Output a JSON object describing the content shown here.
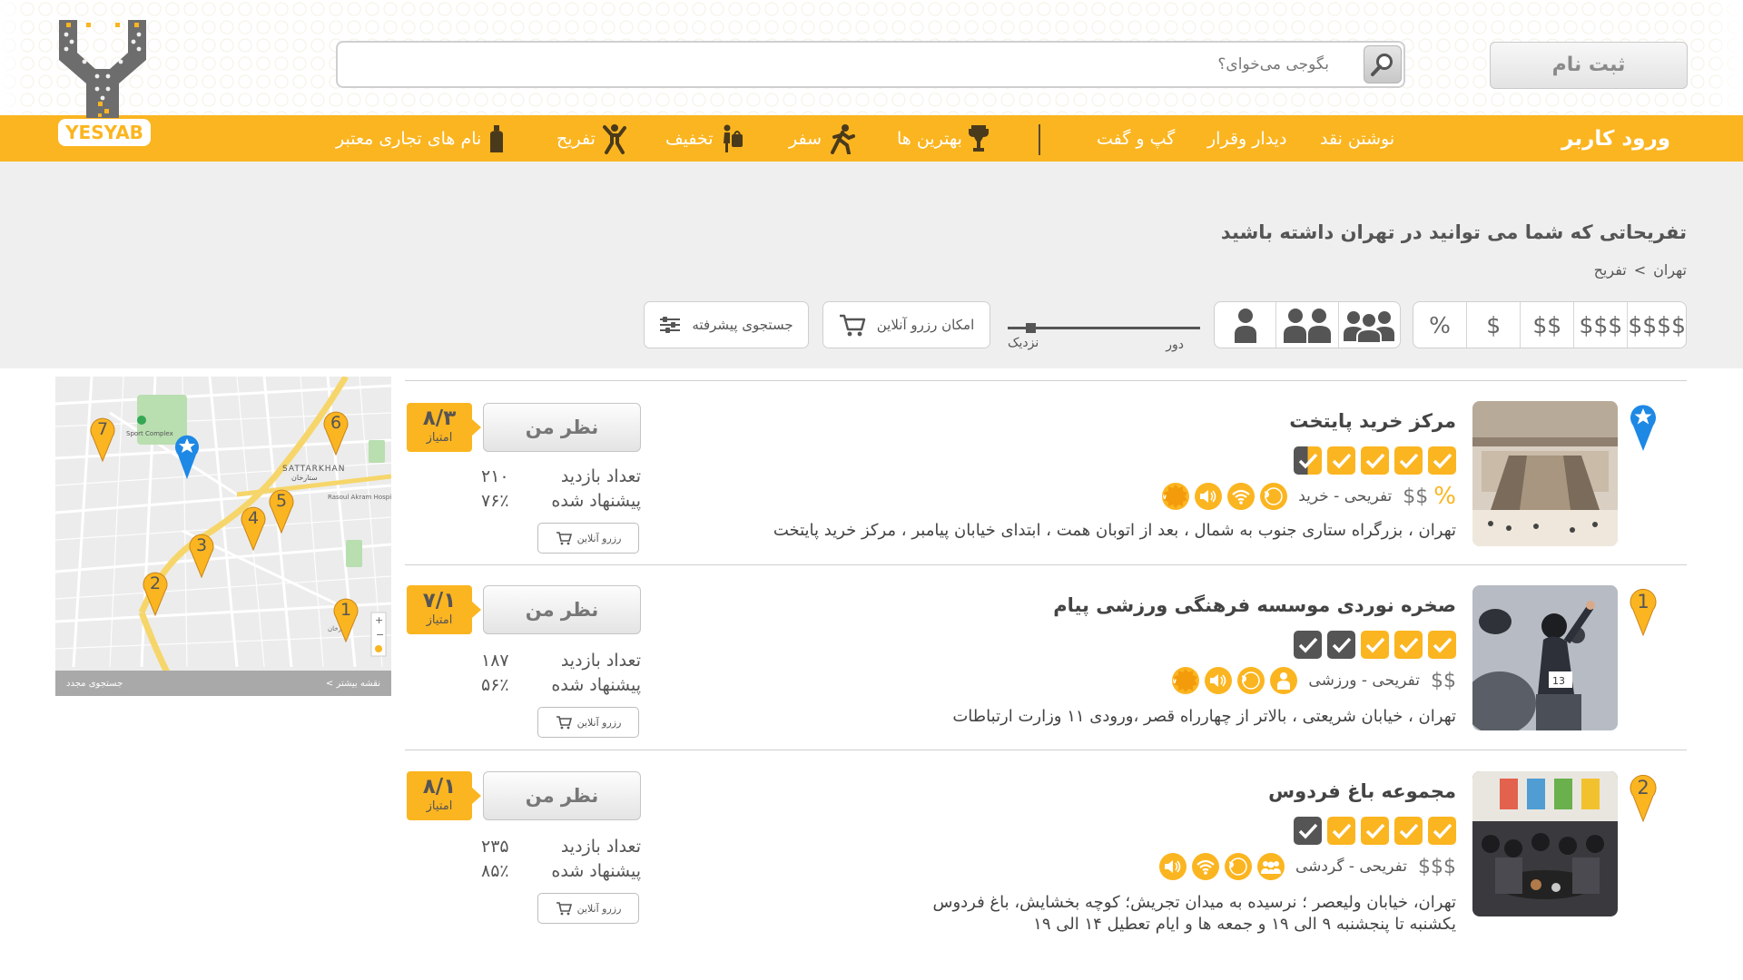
{
  "header": {
    "logo_text": "YESYAB",
    "search_placeholder": "بگوجی می‌خوای؟",
    "register_label": "ثبت نام"
  },
  "nav": {
    "login_label": "ورود کاربر",
    "items": [
      {
        "label": "نوشتن نقد",
        "icon": null
      },
      {
        "label": "دیدار وقرار",
        "icon": null
      },
      {
        "label": "گپ و گفت",
        "icon": null
      },
      {
        "label": "بهترین ها",
        "icon": "trophy-icon"
      },
      {
        "label": "سفر",
        "icon": "traveler-icon"
      },
      {
        "label": "تخفیف",
        "icon": "discount-bag-icon"
      },
      {
        "label": "تفریح",
        "icon": "jumping-person-icon"
      },
      {
        "label": "نام های تجاری معتبر",
        "icon": "brand-bottle-icon"
      }
    ]
  },
  "page": {
    "title": "تفریحاتی که شما می توانید در تهران داشته باشید",
    "breadcrumb": [
      "تهران",
      ">",
      "تفریح"
    ]
  },
  "filters": {
    "price_options": [
      "%",
      "$",
      "$$",
      "$$$",
      "$$$$"
    ],
    "people_options": [
      "single-person-icon",
      "couple-icon",
      "group-icon"
    ],
    "distance": {
      "far_label": "دور",
      "near_label": "نزدیک",
      "value": 0.1
    },
    "online_reserve_label": "امکان رزرو آنلاین",
    "advanced_search_label": "جستجوی پیشرفته"
  },
  "results": [
    {
      "rank": "",
      "name": "مرکز خرید پایتخت",
      "checks": [
        true,
        true,
        true,
        true,
        "half"
      ],
      "discount": "%",
      "price": "$$",
      "category": "تفریحی - خرید",
      "amenities": [
        "parking-icon",
        "wifi-icon",
        "sound-icon",
        "new-badge-icon"
      ],
      "address": [
        "تهران ، بزرگراه ستاری جنوب به شمال ، بعد از اتوبان همت ، ابتدای خیابان پیامبر ، مرکز خرید پایتخت"
      ],
      "opinion_label": "نظر من",
      "score": "۸/۳",
      "score_label": "امتیاز",
      "visits_label": "تعداد بازدید",
      "visits": "۲۱۰",
      "recommended_label": "پیشنهاد شده",
      "recommended": "۷۶٪",
      "reserve_label": "رزرو آنلاین"
    },
    {
      "rank": "1",
      "name": "صخره نوردی موسسه فرهنگی ورزشی پیام",
      "checks": [
        true,
        true,
        true,
        false,
        false
      ],
      "discount": "",
      "price": "$$",
      "category": "تفریحی - ورزشی",
      "amenities": [
        "single-person-icon",
        "parking-icon",
        "sound-icon",
        "new-badge-icon"
      ],
      "address": [
        "تهران ، خیابان شریعتی ، بالاتر از چهارراه قصر ،ورودی ۱۱ وزارت ارتباطات"
      ],
      "opinion_label": "نظر من",
      "score": "۷/۱",
      "score_label": "امتیاز",
      "visits_label": "تعداد بازدید",
      "visits": "۱۸۷",
      "recommended_label": "پیشنهاد شده",
      "recommended": "۵۶٪",
      "reserve_label": "رزرو آنلاین"
    },
    {
      "rank": "2",
      "name": "مجموعه باغ فردوس",
      "checks": [
        true,
        true,
        true,
        true,
        false
      ],
      "discount": "",
      "price": "$$$",
      "category": "تفریحی - گردشی",
      "amenities": [
        "group-icon",
        "parking-icon",
        "wifi-icon",
        "sound-icon"
      ],
      "address": [
        "تهران، خیابان ولیعصر ؛ نرسیده به میدان تجریش؛ کوچه بخشایش، باغ فردوس",
        "یکشنبه تا پنجشنبه ۹ الی ۱۹ و جمعه ها و ایام تعطیل ۱۴ الی ۱۹"
      ],
      "opinion_label": "نظر من",
      "score": "۸/۱",
      "score_label": "امتیاز",
      "visits_label": "تعداد بازدید",
      "visits": "۲۳۵",
      "recommended_label": "پیشنهاد شده",
      "recommended": "۸۵٪",
      "reserve_label": "رزرو آنلاین"
    }
  ],
  "map": {
    "labels": [
      "SATTARKHAN",
      "ستارخان",
      "Rasoul Akram Hospital",
      "Sport Complex",
      "ستارخان"
    ],
    "markers": [
      "1",
      "2",
      "3",
      "4",
      "5",
      "6",
      "7"
    ],
    "footer_right": "نقشه بیشتر >",
    "footer_left": "جستجوی مجدد"
  },
  "colors": {
    "accent": "#fbb520",
    "dark_check": "#555555",
    "band": "#efefef"
  }
}
